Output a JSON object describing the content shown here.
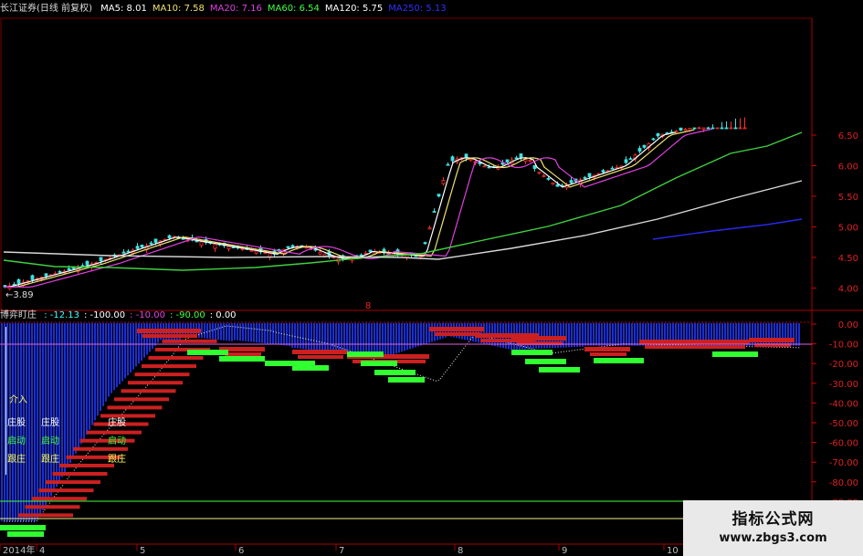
{
  "header": {
    "title": "长江证券(日线 前复权)",
    "ma": [
      {
        "label": "MA5: 8.01",
        "color": "#ffffff"
      },
      {
        "label": "MA10: 7.58",
        "color": "#f0e070"
      },
      {
        "label": "MA20: 7.16",
        "color": "#e040e0"
      },
      {
        "label": "MA60: 6.54",
        "color": "#40ff40"
      },
      {
        "label": "MA120: 5.75",
        "color": "#ffffff"
      },
      {
        "label": "MA250: 5.13",
        "color": "#3030ff"
      }
    ]
  },
  "price_axis": {
    "ticks": [
      "6.50",
      "6.00",
      "5.50",
      "5.00",
      "4.50",
      "4.00"
    ],
    "min_label": "3.89"
  },
  "indicator": {
    "name": "博弈盯庄",
    "values": [
      {
        "label": ": -12.13",
        "color": "#40ffff"
      },
      {
        "label": ": -100.00",
        "color": "#ffffff"
      },
      {
        "label": ": -10.00",
        "color": "#e040e0"
      },
      {
        "label": ": -90.00",
        "color": "#40ff40"
      },
      {
        "label": ": 0.00",
        "color": "#ffffff"
      }
    ],
    "axis_ticks": [
      "0.00",
      "-10.00",
      "-20.00",
      "-30.00",
      "-40.00",
      "-50.00",
      "-60.00",
      "-70.00",
      "-80.00",
      "-90.00"
    ],
    "annotations": [
      {
        "text": "介入",
        "color": "#ffff60"
      },
      {
        "text": "庄股",
        "color": "#ffffff"
      },
      {
        "text": "庄股",
        "color": "#ffffff"
      },
      {
        "text": "庄股",
        "color": "#ffffff"
      },
      {
        "text": "启动",
        "color": "#40ff40"
      },
      {
        "text": "启动",
        "color": "#40ff40"
      },
      {
        "text": "启动",
        "color": "#40ff40"
      },
      {
        "text": "跟庄",
        "color": "#ffff60"
      },
      {
        "text": "跟庄",
        "color": "#ffff60"
      },
      {
        "text": "跟庄",
        "color": "#ffff60"
      }
    ],
    "marker": "8"
  },
  "time_axis": {
    "labels": [
      "2014年",
      "4",
      "5",
      "6",
      "7",
      "8",
      "9",
      "10"
    ]
  },
  "watermark": {
    "title": "指标公式网",
    "url": "www.zbgs3.com"
  },
  "chart_data": [
    {
      "type": "line",
      "title": "长江证券(日线 前复权)",
      "ylim": [
        3.85,
        6.6
      ],
      "x": [
        "2014年",
        "4",
        "5",
        "6",
        "7",
        "8",
        "9",
        "10"
      ],
      "series": [
        {
          "name": "MA5",
          "values": [
            3.95,
            4.55,
            4.72,
            4.62,
            4.68,
            6.05,
            5.75,
            6.4
          ]
        },
        {
          "name": "MA10",
          "values": [
            3.93,
            4.5,
            4.7,
            4.62,
            4.66,
            5.8,
            5.82,
            6.3
          ]
        },
        {
          "name": "MA20",
          "values": [
            3.92,
            4.45,
            4.66,
            4.62,
            4.64,
            5.5,
            5.85,
            6.2
          ]
        },
        {
          "name": "MA60",
          "values": [
            4.35,
            4.4,
            4.45,
            4.48,
            4.55,
            4.95,
            5.35,
            6.5
          ]
        },
        {
          "name": "MA120",
          "values": [
            null,
            4.65,
            4.6,
            4.55,
            4.55,
            4.55,
            5.05,
            5.6
          ]
        },
        {
          "name": "MA250",
          "values": [
            null,
            null,
            null,
            null,
            null,
            null,
            4.95,
            5.1
          ]
        }
      ]
    },
    {
      "type": "area",
      "title": "博弈盯庄",
      "ylim": [
        -100,
        0
      ],
      "x": [
        "2014年",
        "4",
        "5",
        "6",
        "7",
        "8",
        "9",
        "10"
      ],
      "series": [
        {
          "name": "博弈盯庄",
          "values": [
            -100,
            -95,
            -12,
            -15,
            -25,
            -10,
            -15,
            -12.13
          ]
        }
      ]
    }
  ]
}
